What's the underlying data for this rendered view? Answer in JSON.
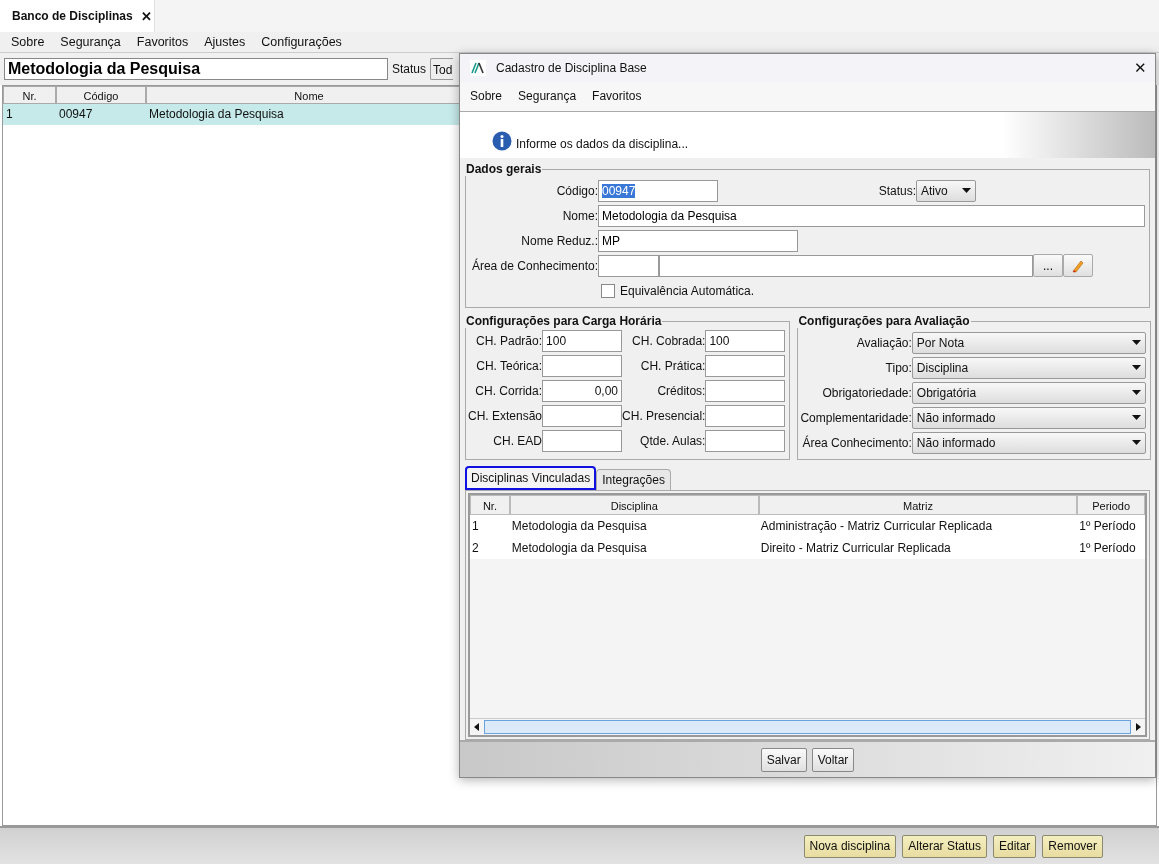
{
  "tab": {
    "label": "Banco de Disciplinas",
    "close": "✕"
  },
  "menu": [
    "Sobre",
    "Segurança",
    "Favoritos",
    "Ajustes",
    "Configurações"
  ],
  "filter": {
    "value": "Metodologia da Pesquisa",
    "status_label": "Status",
    "status_value": "Tod"
  },
  "table": {
    "columns": [
      "Nr.",
      "Código",
      "Nome"
    ],
    "rows": [
      {
        "cells": [
          "1",
          "00947",
          "Metodologia da Pesquisa"
        ],
        "selected": true
      }
    ]
  },
  "actions": [
    "Nova disciplina",
    "Alterar Status",
    "Editar",
    "Remover"
  ],
  "dialog": {
    "title": "Cadastro de Disciplina Base",
    "close": "✕",
    "menu": [
      "Sobre",
      "Segurança",
      "Favoritos"
    ],
    "info": "Informe os dados da disciplina...",
    "general": {
      "title": "Dados gerais",
      "codigo": {
        "label": "Código:",
        "value": "00947",
        "selected": true
      },
      "status": {
        "label": "Status:",
        "value": "Ativo"
      },
      "nome": {
        "label": "Nome:",
        "value": "Metodologia da Pesquisa"
      },
      "nome_reduz": {
        "label": "Nome Reduz.:",
        "value": "MP"
      },
      "area": {
        "label": "Área de Conhecimento:",
        "browse": "..."
      },
      "equivalencia": {
        "label": "Equivalência Automática.",
        "checked": false
      }
    },
    "workload": {
      "title": "Configurações para Carga Horária",
      "fields": [
        {
          "label": "CH. Padrão:",
          "value": "100",
          "kind": "text"
        },
        {
          "label": "CH. Cobrada:",
          "value": "100",
          "kind": "text"
        },
        {
          "label": "CH. Teórica:",
          "kind": "text"
        },
        {
          "label": "CH. Prática:",
          "kind": "text"
        },
        {
          "label": "CH. Corrida:",
          "value": "0,00",
          "kind": "number"
        },
        {
          "label": "Créditos:",
          "kind": "text"
        },
        {
          "label": "CH. Extensão",
          "kind": "text"
        },
        {
          "label": "CH. Presencial:",
          "kind": "text"
        },
        {
          "label": "CH. EAD",
          "kind": "text"
        },
        {
          "label": "Qtde. Aulas:",
          "kind": "text"
        }
      ]
    },
    "evaluation": {
      "title": "Configurações para Avaliação",
      "fields": [
        {
          "label": "Avaliação:",
          "value": "Por Nota"
        },
        {
          "label": "Tipo:",
          "value": "Disciplina"
        },
        {
          "label": "Obrigatoriedade:",
          "value": "Obrigatória"
        },
        {
          "label": "Complementaridade:",
          "value": "Não informado"
        },
        {
          "label": "Área Conhecimento:",
          "value": "Não informado"
        }
      ]
    },
    "tabs": [
      {
        "label": "Disciplinas Vinculadas",
        "selected": true
      },
      {
        "label": "Integrações",
        "selected": false
      }
    ],
    "table": {
      "columns": [
        "Nr.",
        "Disciplina",
        "Matriz",
        "Periodo"
      ],
      "rows": [
        {
          "cells": [
            "1",
            "Metodologia da Pesquisa",
            "Administração - Matriz Curricular Replicada",
            "1º Período"
          ]
        },
        {
          "cells": [
            "2",
            "Metodologia da Pesquisa",
            "Direito - Matriz Curricular Replicada",
            "1º Período"
          ]
        }
      ]
    },
    "buttons": [
      "Salvar",
      "Voltar"
    ]
  }
}
